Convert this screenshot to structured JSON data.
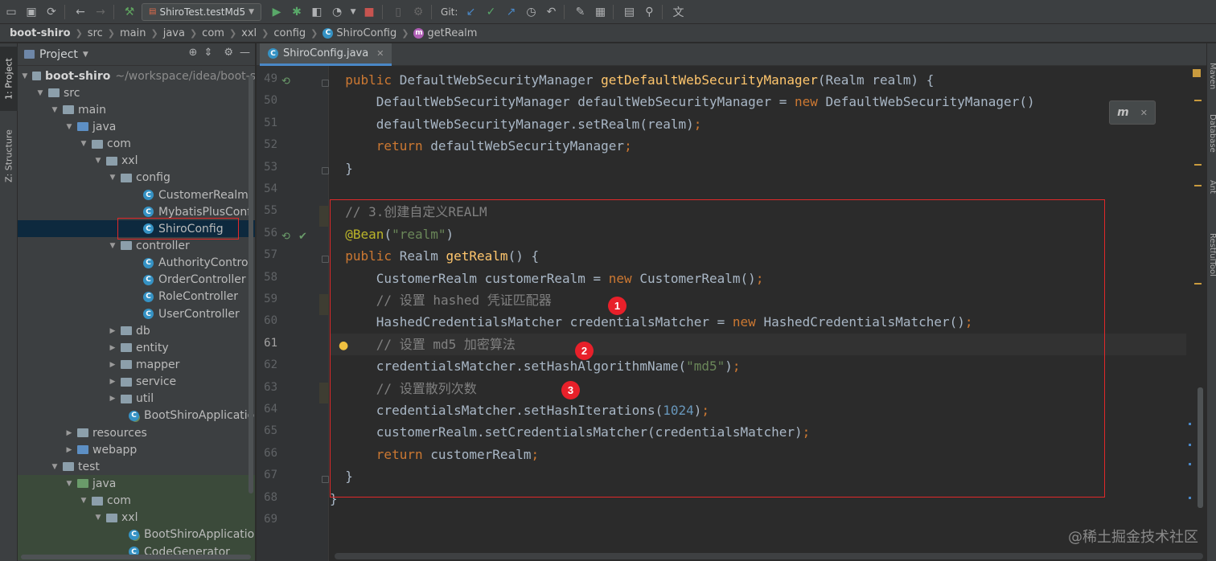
{
  "toolbar": {
    "run_config": "ShiroTest.testMd5",
    "git_label": "Git:"
  },
  "breadcrumb": {
    "items": [
      "boot-shiro",
      "src",
      "main",
      "java",
      "com",
      "xxl",
      "config",
      "ShiroConfig",
      "getRealm"
    ]
  },
  "left_tabs": [
    "1: Project",
    "Z: Structure"
  ],
  "project": {
    "title": "Project",
    "root_name": "boot-shiro",
    "root_path": "~/workspace/idea/boot-s",
    "tree": [
      "src",
      "main",
      "java",
      "com",
      "xxl",
      "config",
      "CustomerRealm",
      "MybatisPlusConf",
      "ShiroConfig",
      "controller",
      "AuthorityControl",
      "OrderController",
      "RoleController",
      "UserController",
      "db",
      "entity",
      "mapper",
      "service",
      "util",
      "BootShiroApplicatio",
      "resources",
      "webapp",
      "test",
      "java",
      "com",
      "xxl",
      "BootShiroApplicatio",
      "CodeGenerator"
    ]
  },
  "editor": {
    "tab_label": "ShiroConfig.java",
    "line_numbers": [
      "49",
      "50",
      "51",
      "52",
      "53",
      "54",
      "55",
      "56",
      "57",
      "58",
      "59",
      "60",
      "61",
      "62",
      "63",
      "64",
      "65",
      "66",
      "67",
      "68",
      "69"
    ],
    "lines": [
      [
        [
          "  public ",
          "kw"
        ],
        [
          "DefaultWebSecurityManager ",
          "pl"
        ],
        [
          "getDefaultWebSecurityManager",
          "fn"
        ],
        [
          "(Realm realm) {",
          "pl"
        ]
      ],
      [
        [
          "      DefaultWebSecurityManager defaultWebSecurityManager = ",
          "pl"
        ],
        [
          "new ",
          "kw"
        ],
        [
          "DefaultWebSecurityManager()",
          "pl"
        ]
      ],
      [
        [
          "      defaultWebSecurityManager.setRealm(realm)",
          "pl"
        ],
        [
          ";",
          "kw"
        ]
      ],
      [
        [
          "      ",
          "pl"
        ],
        [
          "return ",
          "kw"
        ],
        [
          "defaultWebSecurityManager",
          "pl"
        ],
        [
          ";",
          "kw"
        ]
      ],
      [
        [
          "  }",
          "pl"
        ]
      ],
      [
        [
          "",
          "pl"
        ]
      ],
      [
        [
          "  // 3.创建自定义REALM",
          "cm"
        ]
      ],
      [
        [
          "  @Bean",
          "an"
        ],
        [
          "(",
          "pl"
        ],
        [
          "\"realm\"",
          "st"
        ],
        [
          ")",
          "pl"
        ]
      ],
      [
        [
          "  public ",
          "kw"
        ],
        [
          "Realm ",
          "pl"
        ],
        [
          "getRealm",
          "fn"
        ],
        [
          "() {",
          "pl"
        ]
      ],
      [
        [
          "      CustomerRealm customerRealm = ",
          "pl"
        ],
        [
          "new ",
          "kw"
        ],
        [
          "CustomerRealm()",
          "pl"
        ],
        [
          ";",
          "kw"
        ]
      ],
      [
        [
          "      // 设置 hashed 凭证匹配器",
          "cm"
        ]
      ],
      [
        [
          "      HashedCredentialsMatcher credentialsMatcher = ",
          "pl"
        ],
        [
          "new ",
          "kw"
        ],
        [
          "HashedCredentialsMatcher()",
          "pl"
        ],
        [
          ";",
          "kw"
        ]
      ],
      [
        [
          "      // 设置 md5 加密算法",
          "cm"
        ]
      ],
      [
        [
          "      credentialsMatcher.setHashAlgorithmName(",
          "pl"
        ],
        [
          "\"md5\"",
          "st"
        ],
        [
          ")",
          "pl"
        ],
        [
          ";",
          "kw"
        ]
      ],
      [
        [
          "      // 设置散列次数",
          "cm"
        ]
      ],
      [
        [
          "      credentialsMatcher.setHashIterations(",
          "pl"
        ],
        [
          "1024",
          "nm"
        ],
        [
          ")",
          "pl"
        ],
        [
          ";",
          "kw"
        ]
      ],
      [
        [
          "      customerRealm.setCredentialsMatcher(credentialsMatcher)",
          "pl"
        ],
        [
          ";",
          "kw"
        ]
      ],
      [
        [
          "      ",
          "pl"
        ],
        [
          "return ",
          "kw"
        ],
        [
          "customerRealm",
          "pl"
        ],
        [
          ";",
          "kw"
        ]
      ],
      [
        [
          "  }",
          "pl"
        ]
      ],
      [
        [
          "}",
          "pl"
        ]
      ],
      [
        [
          "",
          "pl"
        ]
      ]
    ]
  },
  "annotations": [
    "1",
    "2",
    "3"
  ],
  "popup_label": "m",
  "right_tabs": [
    "Maven",
    "Database",
    "Ant",
    "RestfulTool"
  ],
  "watermark": "@稀土掘金技术社区",
  "colors": {
    "keyword": "#cc7832",
    "function": "#ffc66d",
    "comment": "#808080",
    "annotation": "#bbb529",
    "string": "#6a8759",
    "number": "#6897bb",
    "highlight_box": "#e0292a"
  }
}
